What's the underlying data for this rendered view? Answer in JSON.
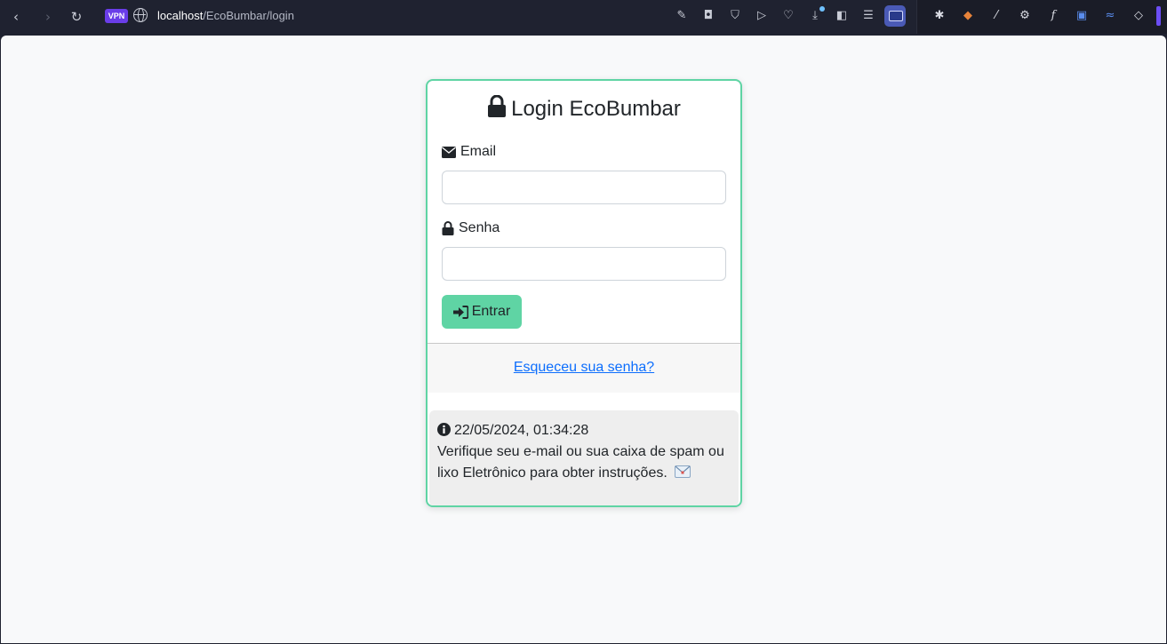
{
  "browser": {
    "vpn_label": "VPN",
    "url_host": "localhost",
    "url_path": "/EcoBumbar/login",
    "nav_icons": [
      "back-icon",
      "forward-icon",
      "reload-icon"
    ],
    "toolbar_icons": [
      "edit-icon",
      "camera-icon",
      "shield-icon",
      "play-icon",
      "heart-icon",
      "download-icon",
      "sidebar-icon",
      "menu-icon",
      "profile-icon"
    ],
    "extension_icons": [
      "bug-icon",
      "fox-icon",
      "eyedropper-icon",
      "gear-icon",
      "font-icon",
      "translate-icon",
      "text-icon",
      "cube-icon"
    ]
  },
  "login": {
    "title": "Login EcoBumbar",
    "email_label": "Email",
    "email_value": "",
    "password_label": "Senha",
    "password_value": "",
    "submit_label": "Entrar",
    "forgot_link": "Esqueceu sua senha?"
  },
  "notice": {
    "timestamp": "22/05/2024, 01:34:28",
    "message": "Verifique seu e-mail ou sua caixa de spam ou lixo Eletrônico para obter instruções."
  },
  "colors": {
    "accent": "#5fd4a4",
    "link": "#0d6efd",
    "page_bg": "#f8f9fa",
    "chrome_bg": "#1f2230"
  }
}
